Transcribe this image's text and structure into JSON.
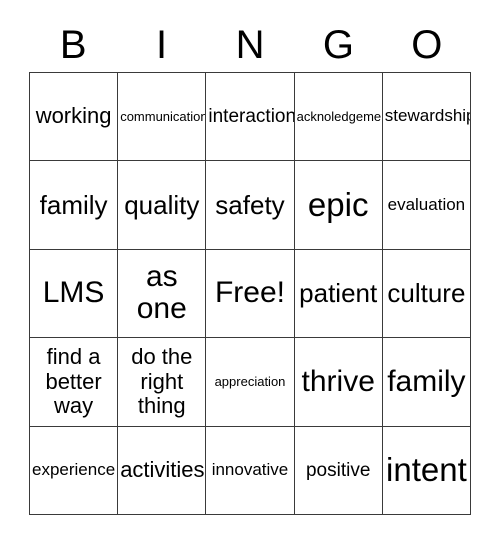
{
  "card": {
    "title_letters": [
      "B",
      "I",
      "N",
      "G",
      "O"
    ],
    "free_space_label": "Free!",
    "grid_line_color": "#3a3a3a",
    "background_color": "#ffffff",
    "text_color": "#000000",
    "rows": 5,
    "columns": 5,
    "cells": [
      [
        {
          "text": "working",
          "size": "fs-l"
        },
        {
          "text": "communication",
          "size": "fs-xs"
        },
        {
          "text": "interaction",
          "size": "fs-m"
        },
        {
          "text": "acknoledgement",
          "size": "fs-xs"
        },
        {
          "text": "stewardship",
          "size": "fs-s"
        }
      ],
      [
        {
          "text": "family",
          "size": "fs-xl"
        },
        {
          "text": "quality",
          "size": "fs-xl"
        },
        {
          "text": "safety",
          "size": "fs-xl"
        },
        {
          "text": "epic",
          "size": "fs-max"
        },
        {
          "text": "evaluation",
          "size": "fs-s"
        }
      ],
      [
        {
          "text": "LMS",
          "size": "fs-xxl"
        },
        {
          "text": "as\none",
          "size": "fs-xxl"
        },
        {
          "text": "Free!",
          "size": "fs-xxl"
        },
        {
          "text": "patient",
          "size": "fs-xl"
        },
        {
          "text": "culture",
          "size": "fs-xl"
        }
      ],
      [
        {
          "text": "find a\nbetter\nway",
          "size": "fs-l"
        },
        {
          "text": "do the\nright\nthing",
          "size": "fs-l"
        },
        {
          "text": "appreciation",
          "size": "fs-xs"
        },
        {
          "text": "thrive",
          "size": "fs-xxl"
        },
        {
          "text": "family",
          "size": "fs-xxl"
        }
      ],
      [
        {
          "text": "experience",
          "size": "fs-s"
        },
        {
          "text": "activities",
          "size": "fs-l"
        },
        {
          "text": "innovative",
          "size": "fs-s"
        },
        {
          "text": "positive",
          "size": "fs-m"
        },
        {
          "text": "intent",
          "size": "fs-max"
        }
      ]
    ]
  }
}
